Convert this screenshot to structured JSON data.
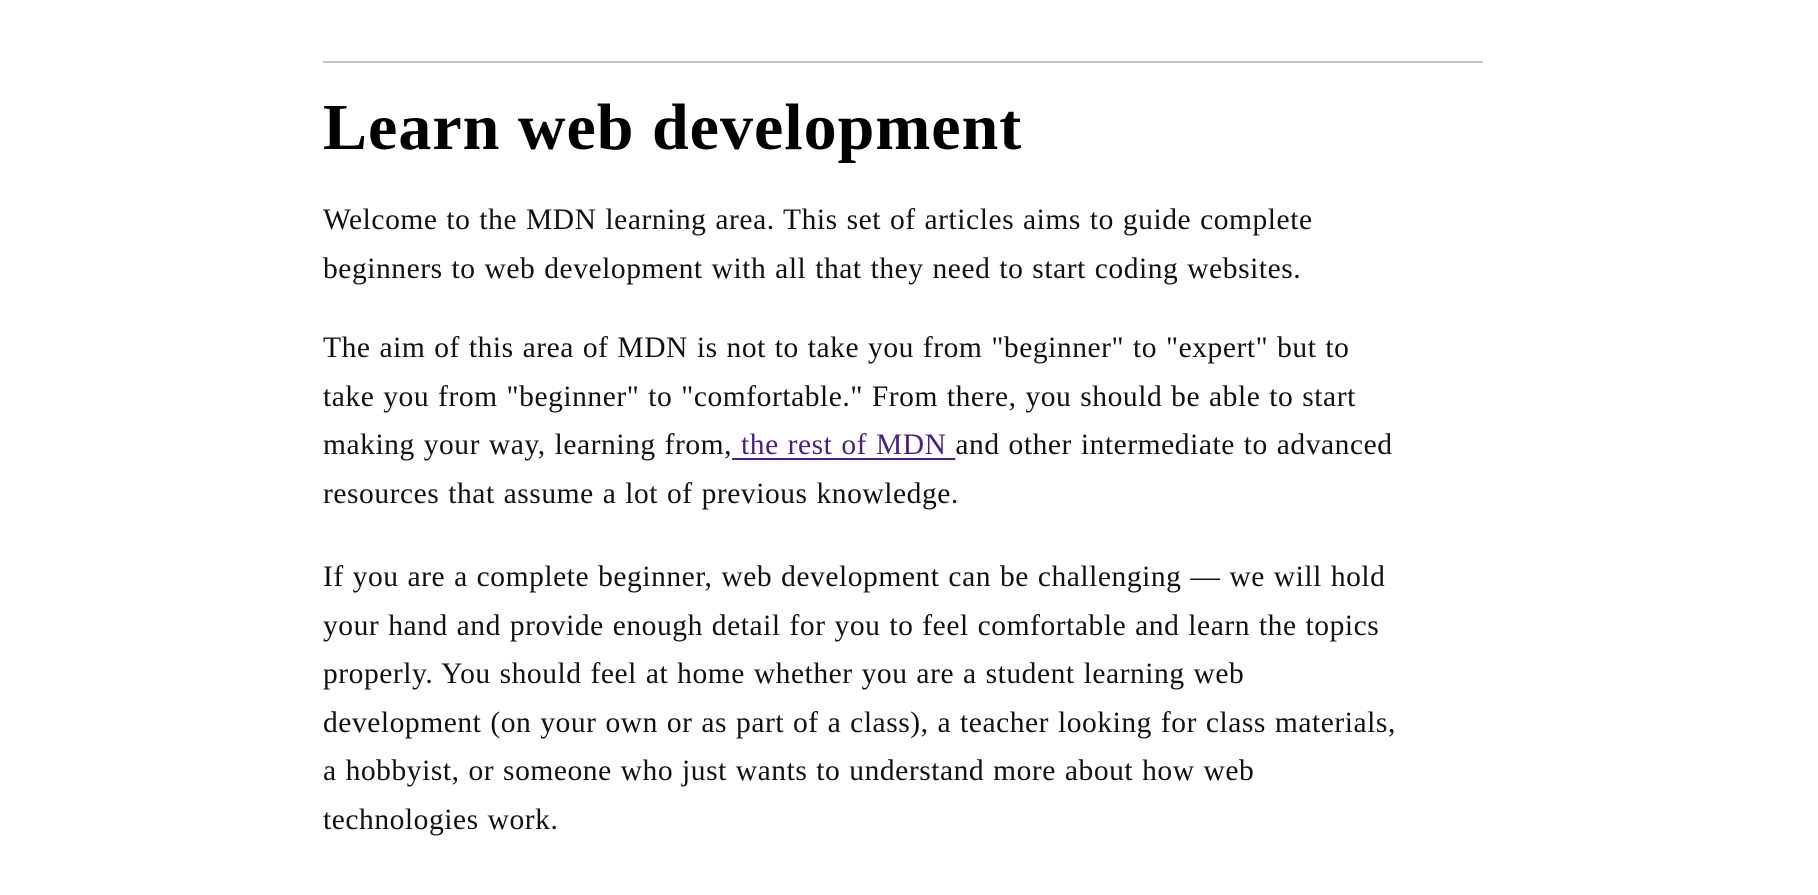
{
  "heading": "Learn web development",
  "paragraph1": {
    "lines": [
      "Welcome to the MDN learning area. This set of articles aims to guide complete",
      "beginners to web development with all that they need to start coding websites."
    ]
  },
  "paragraph2": {
    "line1": "The aim of this area of MDN is not to take you from \"beginner\" to \"expert\" but to",
    "line2": "take you from \"beginner\" to \"comfortable.\" From there, you should be able to start",
    "line3_before": "making your way, learning from,",
    "link_text": " the rest of MDN ",
    "line3_after": "and other intermediate to advanced",
    "line4": "resources that assume a lot of previous knowledge."
  },
  "paragraph3": {
    "lines": [
      "If you are a complete beginner, web development can be challenging — we will hold",
      "your hand and provide enough detail for you to feel comfortable and learn the topics",
      "properly. You should feel at home whether you are a student learning web",
      "development (on your own or as part of a class), a teacher looking for class materials,",
      "a hobbyist, or someone who just wants to understand more about how web",
      "technologies work."
    ]
  },
  "colors": {
    "link": "#4b1d8c",
    "text": "#111111",
    "rule": "#c4c4c4"
  }
}
